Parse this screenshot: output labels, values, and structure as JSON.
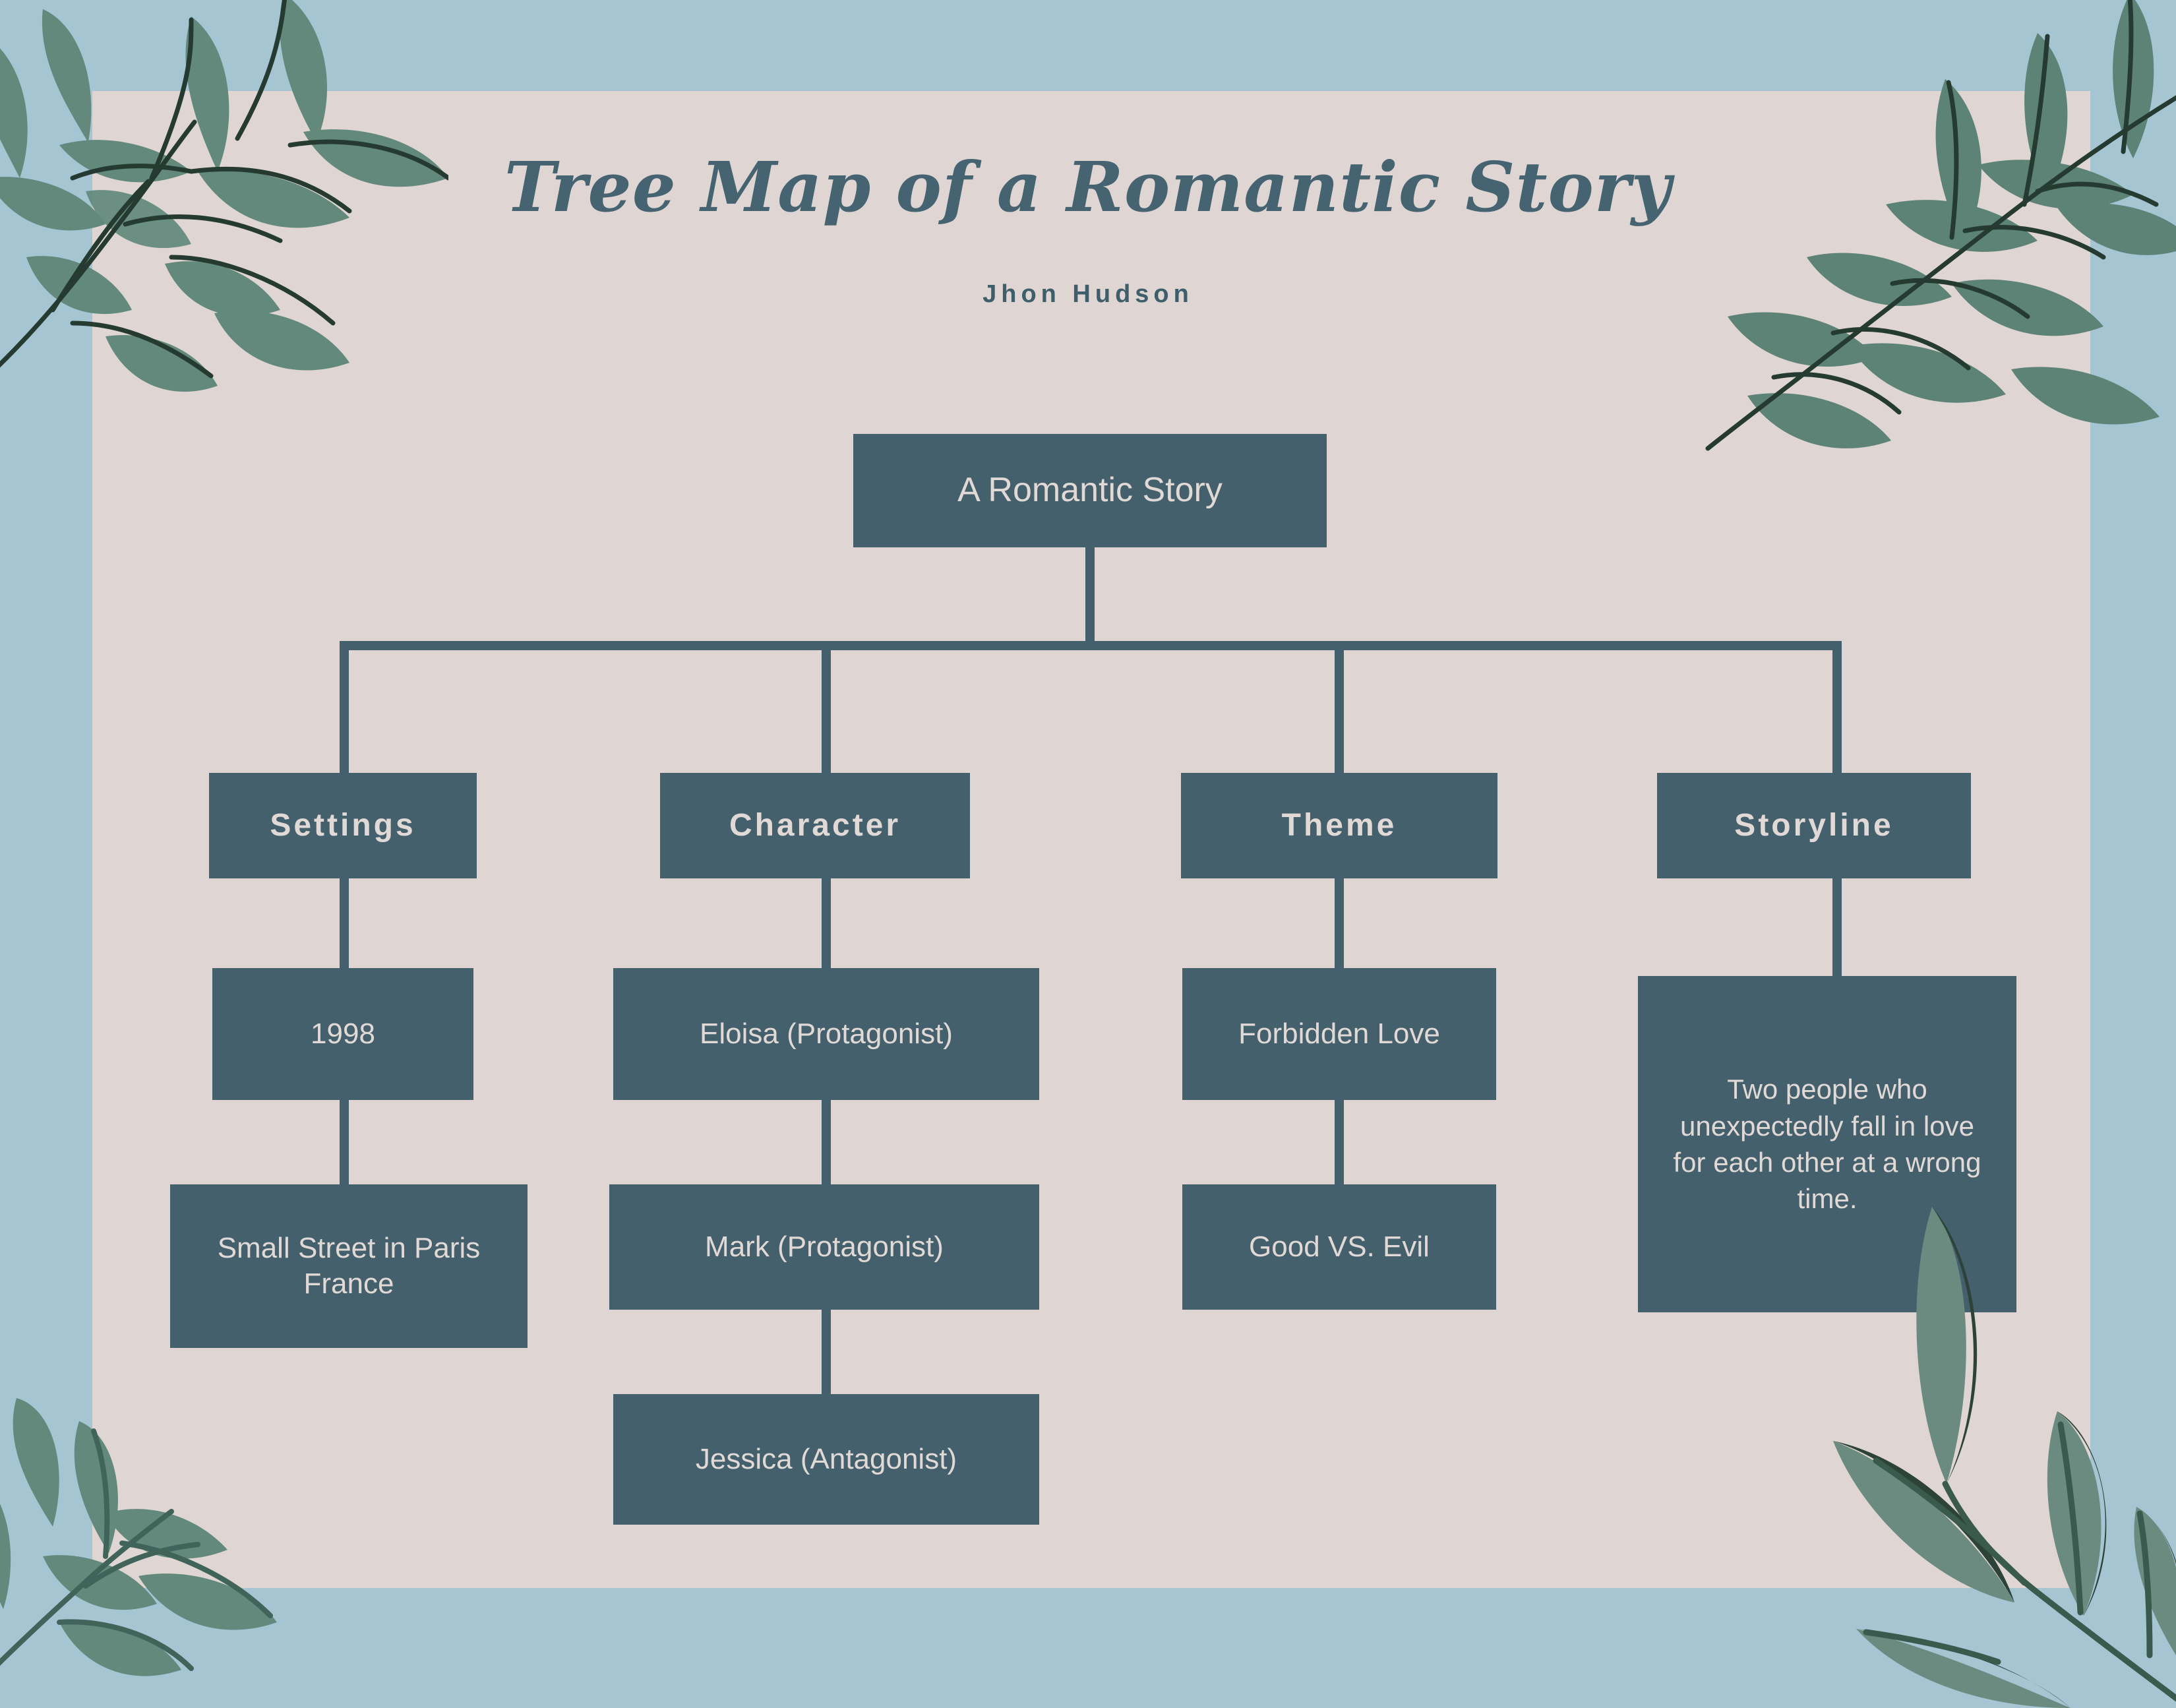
{
  "header": {
    "title": "Tree Map of a Romantic Story",
    "author": "Jhon Hudson"
  },
  "colors": {
    "border_blue": "#A5C5D3",
    "panel_cream": "#DFD6D3",
    "node_slate": "#45606D",
    "node_text": "#E0D9D5",
    "heading_text": "#456370",
    "leaf_sage": "#62897C",
    "leaf_dark": "#2D4239",
    "stem_dark": "#253A30"
  },
  "tree": {
    "root": {
      "label": "A Romantic Story"
    },
    "branches": [
      {
        "category": "Settings",
        "children": [
          {
            "label": "1998"
          },
          {
            "label": "Small Street in Paris France"
          }
        ]
      },
      {
        "category": "Character",
        "children": [
          {
            "label": "Eloisa (Protagonist)"
          },
          {
            "label": "Mark (Protagonist)"
          },
          {
            "label": "Jessica (Antagonist)"
          }
        ]
      },
      {
        "category": "Theme",
        "children": [
          {
            "label": "Forbidden Love"
          },
          {
            "label": "Good VS.  Evil"
          }
        ]
      },
      {
        "category": "Storyline",
        "children": [
          {
            "label": "Two people who unexpectedly fall in love for each other at a wrong time."
          }
        ]
      }
    ]
  },
  "decor": {
    "top_left": "leaf-branch-icon",
    "top_right": "leaf-branch-icon",
    "bottom_left": "leaf-branch-icon",
    "bottom_right": "leaf-branch-icon"
  }
}
